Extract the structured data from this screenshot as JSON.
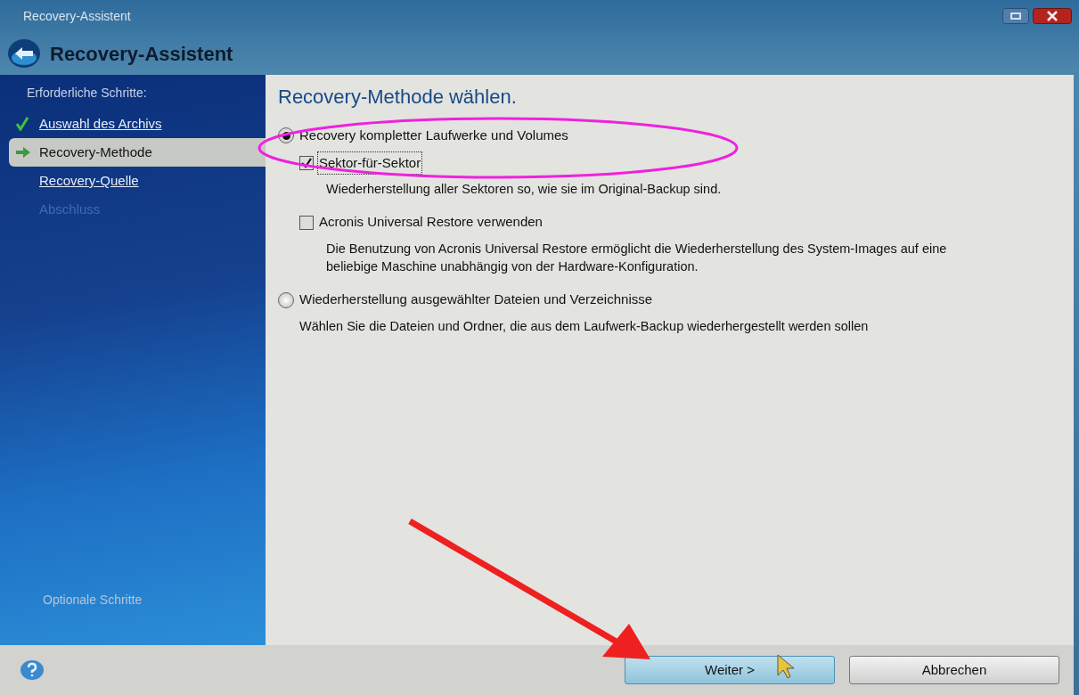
{
  "window": {
    "title": "Recovery-Assistent"
  },
  "header": {
    "title": "Recovery-Assistent"
  },
  "sidebar": {
    "heading": "Erforderliche Schritte:",
    "steps": [
      {
        "label": "Auswahl des Archivs",
        "kind": "done",
        "selected": false
      },
      {
        "label": "Recovery-Methode",
        "kind": "current",
        "selected": true
      },
      {
        "label": "Recovery-Quelle",
        "kind": "link",
        "selected": false
      },
      {
        "label": "Abschluss",
        "kind": "disabled",
        "selected": false
      }
    ],
    "optional_heading": "Optionale Schritte"
  },
  "content": {
    "title": "Recovery-Methode wählen.",
    "options": [
      {
        "kind": "radio",
        "label": "Recovery kompletter Laufwerke und Volumes",
        "selected": true,
        "children": [
          {
            "kind": "checkbox",
            "label": "Sektor-für-Sektor",
            "checked": true,
            "focused": true,
            "description": "Wiederherstellung aller Sektoren so, wie sie im Original-Backup sind."
          },
          {
            "kind": "checkbox",
            "label": "Acronis Universal Restore verwenden",
            "checked": false,
            "description": "Die Benutzung von Acronis Universal Restore ermöglicht die Wiederherstellung des System-Images auf eine beliebige Maschine unabhängig von der Hardware-Konfiguration."
          }
        ]
      },
      {
        "kind": "radio",
        "label": "Wiederherstellung ausgewählter Dateien und Verzeichnisse",
        "selected": false,
        "description": "Wählen Sie die Dateien und Ordner, die aus dem Laufwerk-Backup wiederhergestellt werden sollen"
      }
    ]
  },
  "buttons": [
    {
      "label": "Weiter >",
      "default": true
    },
    {
      "label": "Abbrechen",
      "default": false
    }
  ]
}
